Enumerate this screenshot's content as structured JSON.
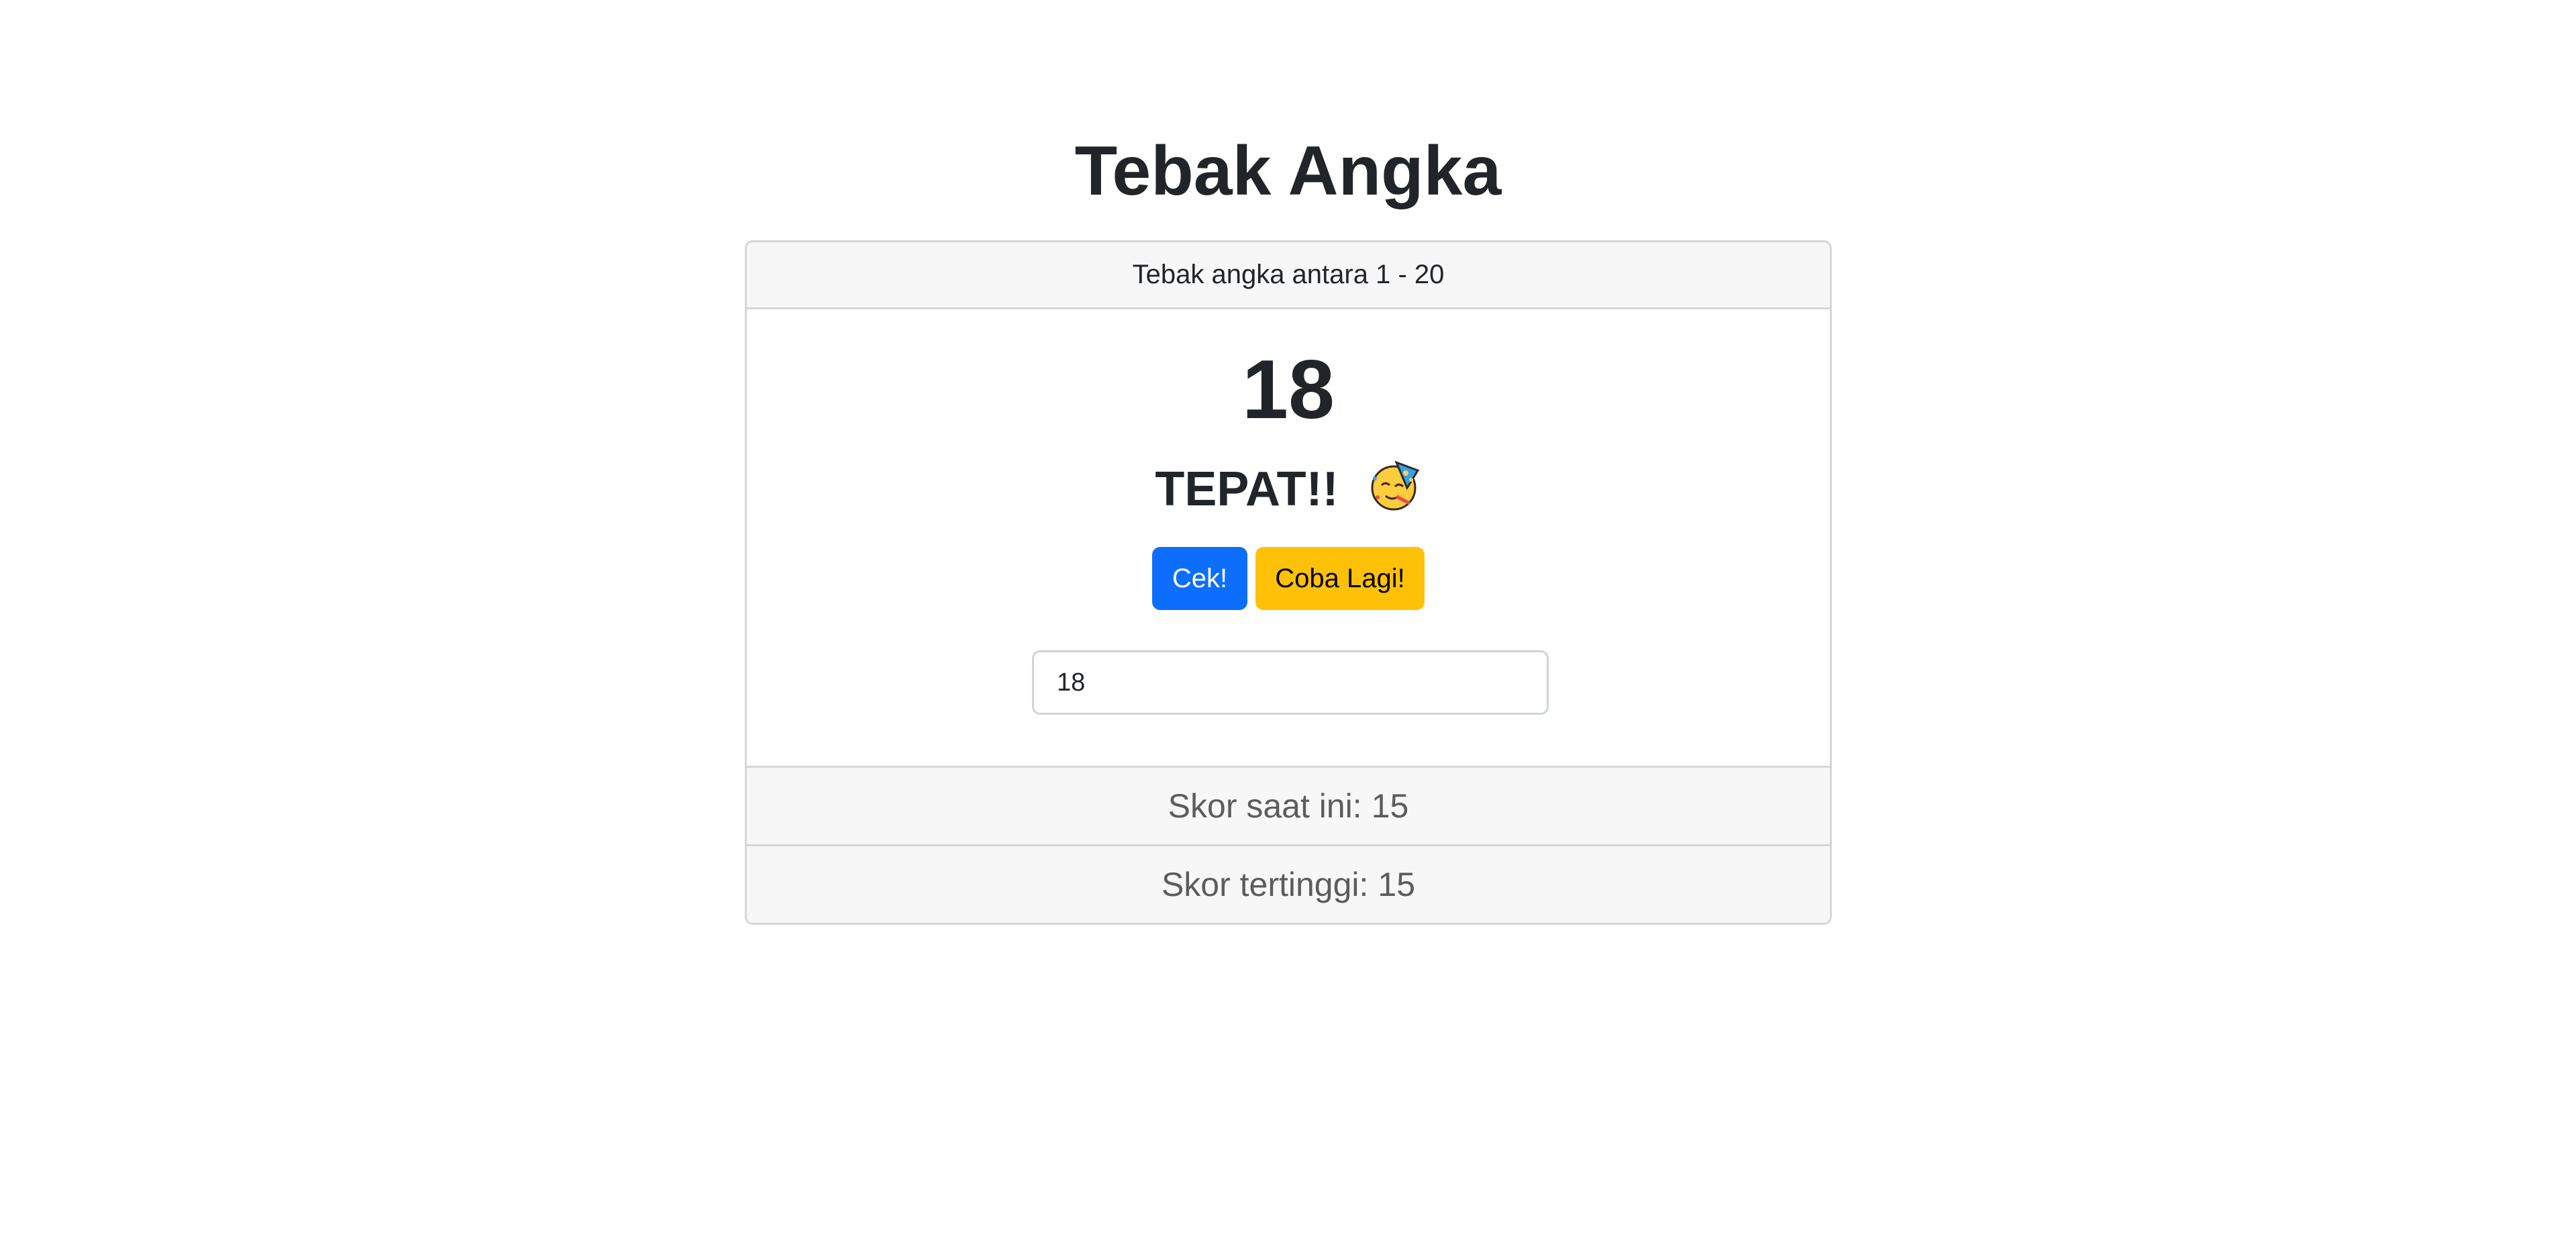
{
  "page": {
    "title": "Tebak Angka"
  },
  "card": {
    "header": "Tebak angka antara 1 - 20",
    "secret_number": "18",
    "message": "TEPAT!!",
    "message_icon": "party-face-icon",
    "buttons": {
      "check_label": "Cek!",
      "retry_label": "Coba Lagi!"
    },
    "guess_input": {
      "value": "18"
    },
    "current_score": {
      "label": "Skor saat ini:",
      "value": "15"
    },
    "high_score": {
      "label": "Skor tertinggi:",
      "value": "15"
    }
  },
  "colors": {
    "primary": "#0d6efd",
    "warning": "#ffc107",
    "text": "#212529",
    "muted": "#5c5c5c",
    "panel": "#f7f7f7"
  }
}
